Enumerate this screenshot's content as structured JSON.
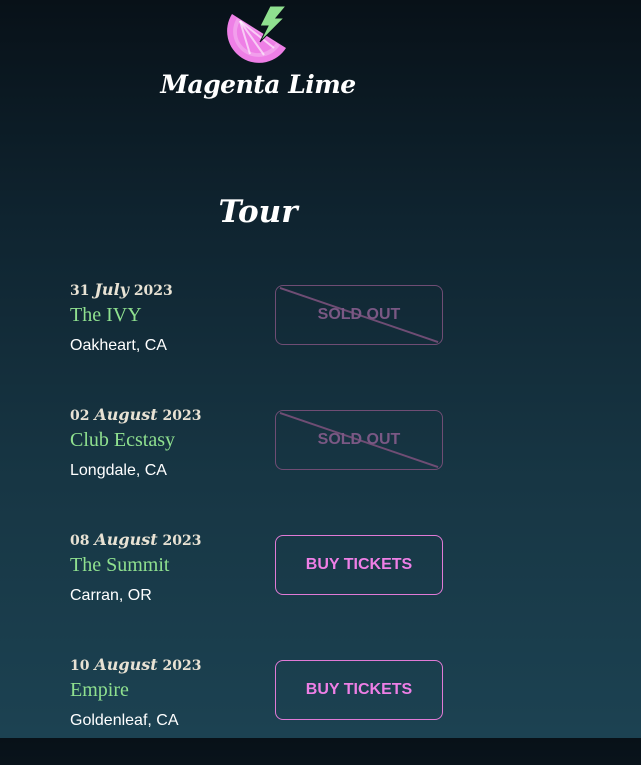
{
  "header": {
    "brand": "Magenta Lime",
    "logo_icon": "lime-slice-lightning-icon"
  },
  "section": {
    "title": "Tour"
  },
  "colors": {
    "accent_magenta": "#ee7fe6",
    "accent_lime": "#8fe08f",
    "sold_out": "#7a5884"
  },
  "tour": [
    {
      "day": "31",
      "month": "July",
      "year": "2023",
      "venue": "The IVY",
      "city": "Oakheart, CA",
      "button": "SOLD OUT",
      "sold_out": true
    },
    {
      "day": "02",
      "month": "August",
      "year": "2023",
      "venue": "Club Ecstasy",
      "city": "Longdale, CA",
      "button": "SOLD OUT",
      "sold_out": true
    },
    {
      "day": "08",
      "month": "August",
      "year": "2023",
      "venue": "The Summit",
      "city": "Carran, OR",
      "button": "BUY TICKETS",
      "sold_out": false
    },
    {
      "day": "10",
      "month": "August",
      "year": "2023",
      "venue": "Empire",
      "city": "Goldenleaf, CA",
      "button": "BUY TICKETS",
      "sold_out": false
    }
  ]
}
